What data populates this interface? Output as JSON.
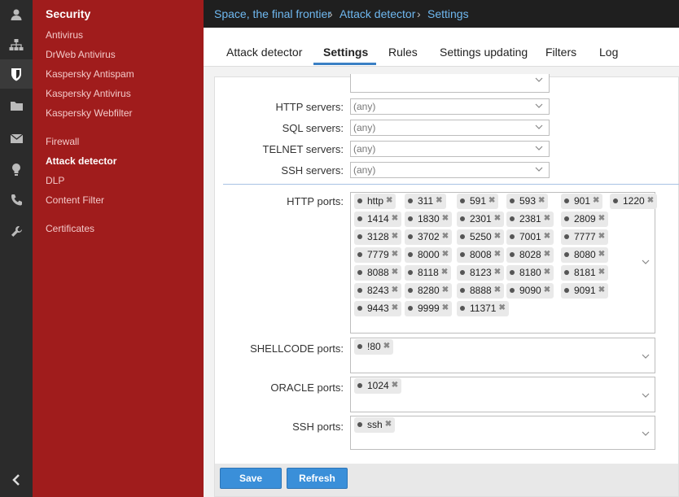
{
  "sidebar": {
    "title": "Security",
    "items": [
      "Antivirus",
      "DrWeb Antivirus",
      "Kaspersky Antispam",
      "Kaspersky Antivirus",
      "Kaspersky Webfilter",
      "Firewall",
      "Attack detector",
      "DLP",
      "Content Filter",
      "Certificates"
    ],
    "active": "Attack detector"
  },
  "rail": {
    "icons": [
      "user-icon",
      "network-icon",
      "shield-icon",
      "folder-icon",
      "mail-icon",
      "lightbulb-icon",
      "phone-icon",
      "wrench-icon",
      "collapse-icon"
    ]
  },
  "breadcrumb": [
    "Space, the final frontier",
    "Attack detector",
    "Settings"
  ],
  "tabs": [
    "Attack detector",
    "Settings",
    "Rules",
    "Settings updating",
    "Filters",
    "Log"
  ],
  "active_tab": "Settings",
  "servers": [
    {
      "label": "HTTP servers:",
      "value": "(any)"
    },
    {
      "label": "SQL servers:",
      "value": "(any)"
    },
    {
      "label": "TELNET servers:",
      "value": "(any)"
    },
    {
      "label": "SSH servers:",
      "value": "(any)"
    }
  ],
  "ports": {
    "http": {
      "label": "HTTP ports:",
      "tags": [
        [
          "http",
          "311",
          "591",
          "593",
          "901",
          "1220"
        ],
        [
          "1414",
          "1830",
          "2301",
          "2381",
          "2809"
        ],
        [
          "3128",
          "3702",
          "5250",
          "7001",
          "7777"
        ],
        [
          "7779",
          "8000",
          "8008",
          "8028",
          "8080"
        ],
        [
          "8088",
          "8118",
          "8123",
          "8180",
          "8181"
        ],
        [
          "8243",
          "8280",
          "8888",
          "9090",
          "9091"
        ],
        [
          "9443",
          "9999",
          "11371"
        ]
      ]
    },
    "shellcode": {
      "label": "SHELLCODE ports:",
      "tags": [
        "!80"
      ]
    },
    "oracle": {
      "label": "ORACLE ports:",
      "tags": [
        "1024"
      ]
    },
    "ssh": {
      "label": "SSH ports:",
      "tags": [
        "ssh"
      ]
    }
  },
  "buttons": {
    "save": "Save",
    "refresh": "Refresh"
  },
  "colors": {
    "sidebar": "#a01c1c",
    "rail": "#2b2b2b",
    "accent": "#3a8fd9",
    "link": "#6fb8f0"
  }
}
